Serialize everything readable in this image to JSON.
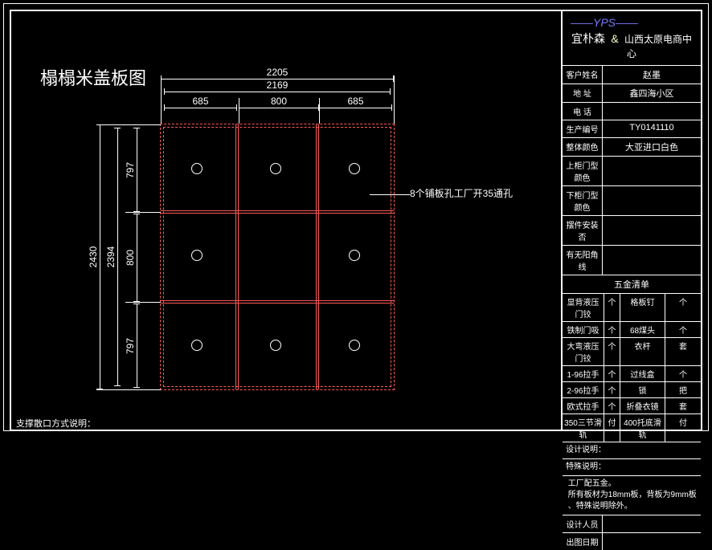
{
  "title": "榻榻米盖板图",
  "callout_text": "8个铺板孔工厂开35通孔",
  "dimensions": {
    "top_outer": "2205",
    "top_inner": "2169",
    "col1": "685",
    "col2": "800",
    "col3": "685",
    "left_outer": "2430",
    "left_inner": "2394",
    "row1": "797",
    "row2": "800",
    "row3": "797"
  },
  "sidebar": {
    "logo": "YPS",
    "company_main": "宜朴森",
    "company_sub": "山西太原电商中心",
    "info": [
      {
        "label": "客户姓名",
        "value": "赵墨"
      },
      {
        "label": "地  址",
        "value": "鑫四海小区"
      },
      {
        "label": "电  话",
        "value": ""
      },
      {
        "label": "生产编号",
        "value": "TY0141110"
      },
      {
        "label": "整体颜色",
        "value": "大亚进口白色"
      },
      {
        "label": "上柜门型颜色",
        "value": ""
      },
      {
        "label": "下柜门型颜色",
        "value": ""
      },
      {
        "label": "摆件安装否",
        "value": ""
      },
      {
        "label": "有无阳角线",
        "value": ""
      }
    ],
    "hw_heading": "五金清单",
    "hardware": [
      {
        "a": "显背液压门铰",
        "u1": "个",
        "b": "格板钉",
        "u2": "个"
      },
      {
        "a": "铁制门吸",
        "u1": "个",
        "b": "68煤头",
        "u2": "个"
      },
      {
        "a": "大弯液压门铰",
        "u1": "个",
        "b": "衣杆",
        "u2": "套"
      },
      {
        "a": "1-96拉手",
        "u1": "个",
        "b": "过线盒",
        "u2": "个"
      },
      {
        "a": "2-96拉手",
        "u1": "个",
        "b": "锁",
        "u2": "把"
      },
      {
        "a": "欧式拉手",
        "u1": "个",
        "b": "折叠衣镜",
        "u2": "套"
      },
      {
        "a": "350三节滑轨",
        "u1": "付",
        "b": "400托底滑轨",
        "u2": "付"
      }
    ],
    "notes_label1": "设计说明：",
    "notes_label2": "特殊说明：",
    "notes_lines": [
      "工厂配五金。",
      "所有板材为18mm板，背板为9mm板",
      "、特殊说明除外。"
    ],
    "notes_label3": "设计人员",
    "notes_label4": "出图日期"
  },
  "footer_left": "支撑散口方式说明："
}
